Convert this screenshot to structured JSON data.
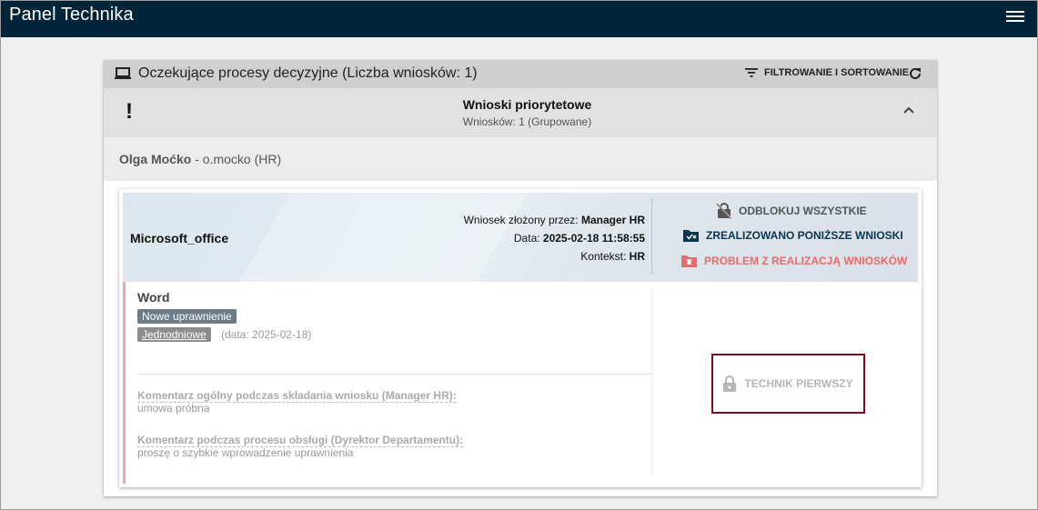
{
  "appbar": {
    "title": "Panel Technika"
  },
  "card": {
    "title": "Oczekujące procesy decyzyjne (Liczba wniosków: 1)",
    "filter_label": "FILTROWANIE I SORTOWANIE"
  },
  "priority": {
    "mark": "!",
    "title": "Wnioski priorytetowe",
    "subtitle": "Wniosków: 1 (Grupowane)"
  },
  "user": {
    "name": "Olga Moćko",
    "detail": " - o.mocko (HR)"
  },
  "request": {
    "app_name": "Microsoft_office",
    "submitted_by_label": "Wniosek złożony przez: ",
    "submitted_by": "Manager HR",
    "date_label": "Data: ",
    "date": "2025-02-18 11:58:55",
    "context_label": "Kontekst: ",
    "context": "HR",
    "actions": {
      "unlock_all": "ODBLOKUJ WSZYSTKIE",
      "done": "ZREALIZOWANO PONIŻSZE WNIOSKI",
      "problem": "PROBLEM Z REALIZACJĄ WNIOSKÓW"
    },
    "item": {
      "name": "Word",
      "badge_type": "Nowe uprawnienie",
      "badge_duration": "Jednodniowe",
      "duration_date": "(data: 2025-02-18)",
      "comment1_label": "Komentarz ogólny podczas składania wniosku (Manager HR):",
      "comment1_text": "umowa próbna",
      "comment2_label": "Komentarz podczas procesu obsługi (Dyrektor Departamentu):",
      "comment2_text": "proszę o szybkie wprowadzenie uprawnienia",
      "tech_button": "TECHNIK PIERWSZY"
    }
  },
  "colors": {
    "appbar": "#032539",
    "done_action": "#0a3550",
    "problem_action": "#e86b6b",
    "highlight_border": "#7a0d1e"
  }
}
